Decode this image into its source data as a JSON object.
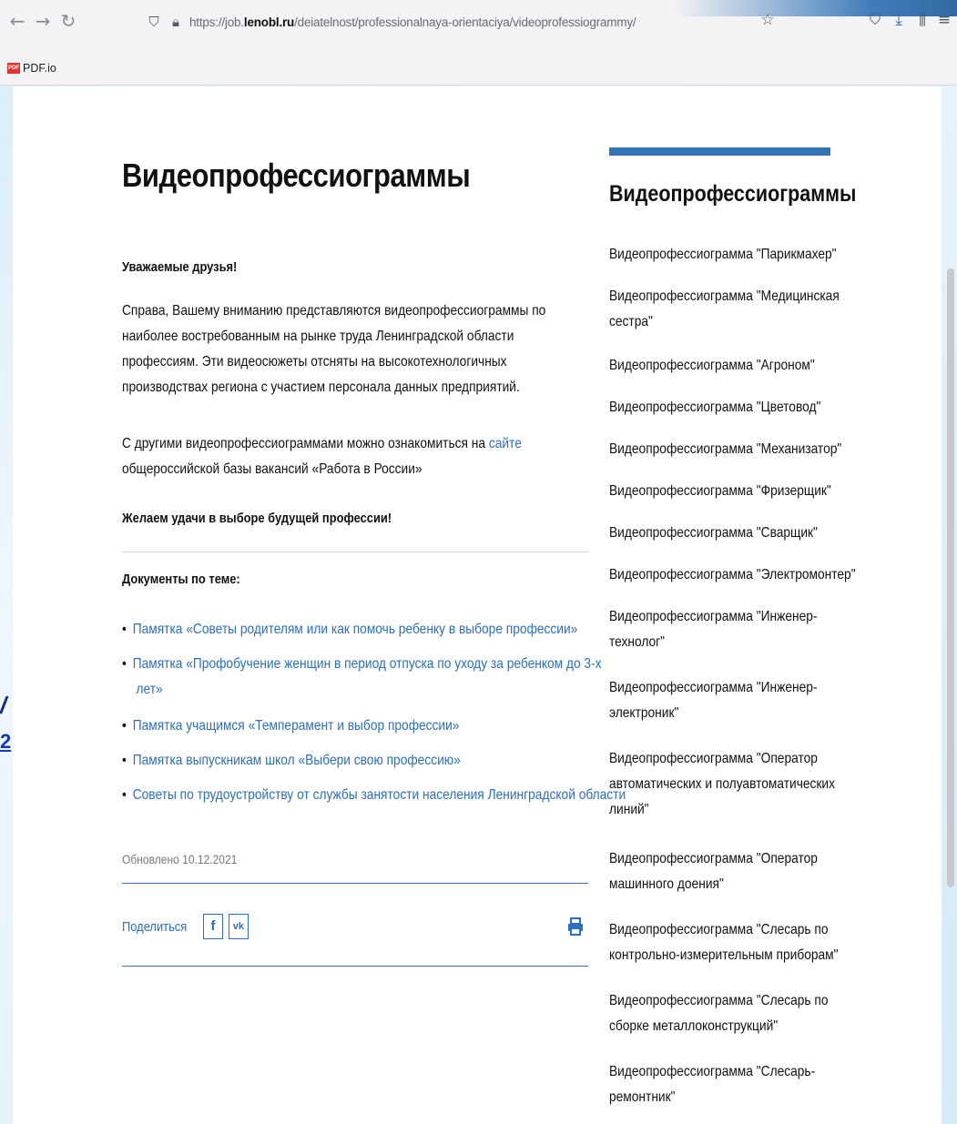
{
  "browser": {
    "url_prefix": "https://job.",
    "url_domain": "lenobl.ru",
    "url_path": "/deiatelnost/professionalnaya-orientaciya/videoprofessiogrammy/",
    "bookmark_icon_text": "PDF",
    "bookmark_label": "PDF.io"
  },
  "edge": {
    "char1": "/",
    "char2": "2"
  },
  "main": {
    "title": "Видеопрофессиограммы",
    "greeting": "Уважаемые друзья!",
    "para1": "Справа, Вашему вниманию представляются видеопрофессиограммы по наиболее востребованным на рынке труда Ленинградской области профессиям. Эти видеосюжеты отсняты на высокотехнологичных производствах региона с участием персонала данных предприятий.",
    "para2_before": "С другими видеопрофессиограммами можно ознакомиться на ",
    "para2_link": "сайте",
    "para2_after": " общероссийской базы вакансий «Работа в России»",
    "wish": "Желаем удачи в выборе будущей профессии!",
    "docs_heading": "Документы по теме:",
    "docs": [
      {
        "line1": "Памятка «Советы родителям или как помочь ребенку в выборе профессии»",
        "line2": ""
      },
      {
        "line1": "Памятка «Профобучение женщин в период отпуска по уходу за ребенком до 3-х",
        "line2": "лет»"
      },
      {
        "line1": "Памятка учащимся «Темперамент и выбор профессии»",
        "line2": ""
      },
      {
        "line1": "Памятка выпускникам школ «Выбери свою профессию»",
        "line2": ""
      },
      {
        "line1": "Советы по трудоустройству от службы занятости населения Ленинградской области",
        "line2": ""
      }
    ],
    "updated": "Обновлено 10.12.2021",
    "share_label": "Поделиться",
    "share_fb": "f",
    "share_vk": "vk"
  },
  "sidebar": {
    "title": "Видеопрофессиограммы",
    "items": [
      {
        "line1": "Видеопрофессиограмма \"Парикмахер\"",
        "line2": "",
        "line3": ""
      },
      {
        "line1": "Видеопрофессиограмма \"Медицинская",
        "line2": "сестра\"",
        "line3": ""
      },
      {
        "line1": "Видеопрофессиограмма \"Агроном\"",
        "line2": "",
        "line3": ""
      },
      {
        "line1": "Видеопрофессиограмма \"Цветовод\"",
        "line2": "",
        "line3": ""
      },
      {
        "line1": "Видеопрофессиограмма \"Механизатор\"",
        "line2": "",
        "line3": ""
      },
      {
        "line1": "Видеопрофессиограмма \"Фризерщик\"",
        "line2": "",
        "line3": ""
      },
      {
        "line1": "Видеопрофессиограмма \"Сварщик\"",
        "line2": "",
        "line3": ""
      },
      {
        "line1": "Видеопрофессиограмма \"Электромонтер\"",
        "line2": "",
        "line3": ""
      },
      {
        "line1": "Видеопрофессиограмма \"Инженер-",
        "line2": "технолог\"",
        "line3": ""
      },
      {
        "line1": "Видеопрофессиограмма \"Инженер-",
        "line2": "электроник\"",
        "line3": ""
      },
      {
        "line1": "Видеопрофессиограмма \"Оператор",
        "line2": "автоматических и полуавтоматических",
        "line3": "линий\""
      },
      {
        "line1": "Видеопрофессиограмма \"Оператор",
        "line2": "машинного доения\"",
        "line3": ""
      },
      {
        "line1": "Видеопрофессиограмма \"Слесарь по",
        "line2": "контрольно-измерительным приборам\"",
        "line3": ""
      },
      {
        "line1": "Видеопрофессиограмма \"Слесарь по",
        "line2": "сборке металлоконструкций\"",
        "line3": ""
      },
      {
        "line1": "Видеопрофессиограмма \"Слесарь-",
        "line2": "ремонтник\"",
        "line3": ""
      }
    ]
  },
  "colors": {
    "link": "#2a6fc0",
    "accent_bar": "#3273b9"
  }
}
